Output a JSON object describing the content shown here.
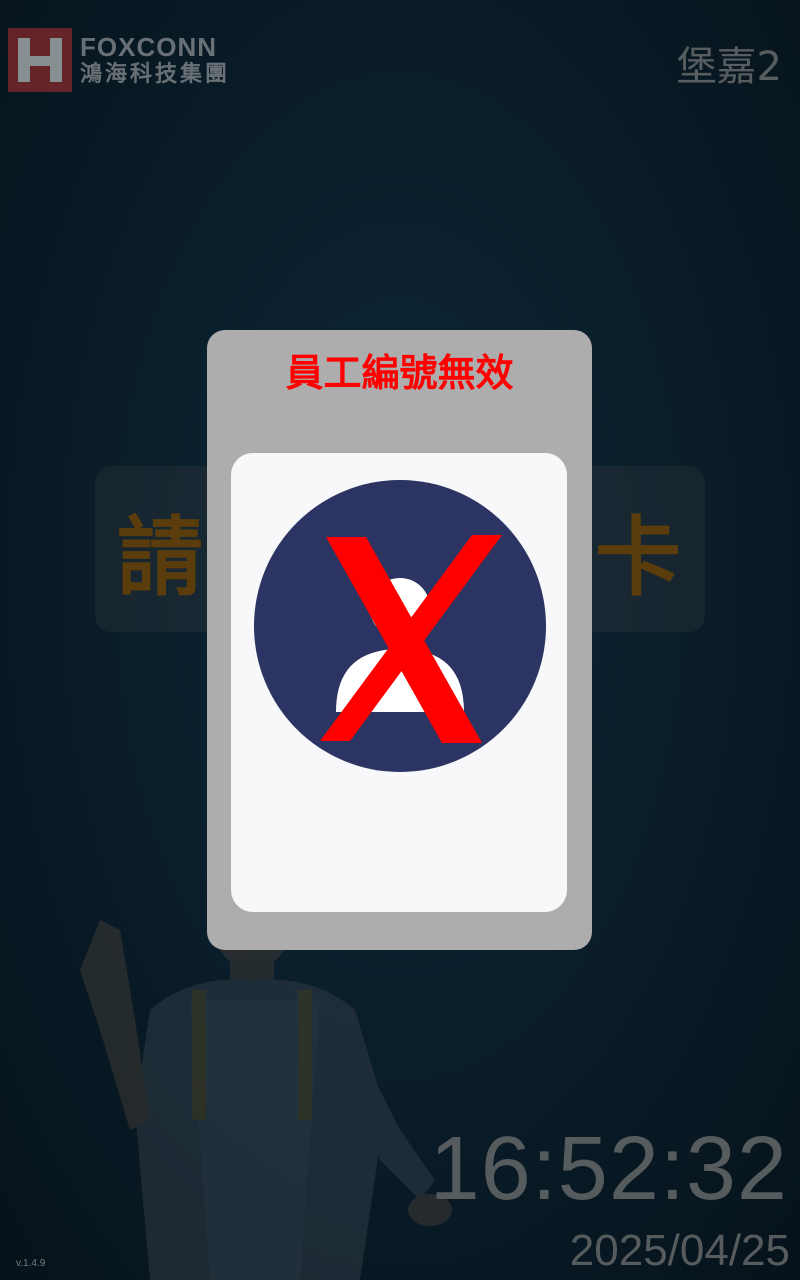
{
  "header": {
    "logo_en": "FOXCONN",
    "logo_zh": "鴻海科技集團",
    "site_name": "堡嘉2"
  },
  "prompt": {
    "left": "請",
    "right": "卡"
  },
  "dialog": {
    "title": "員工編號無效",
    "icon": "invalid-user-icon"
  },
  "footer": {
    "time": "16:52:32",
    "date": "2025/04/25",
    "version": "v.1.4.9"
  },
  "colors": {
    "dialog_title": "#ff0000",
    "avatar_bg": "#2b3462",
    "cross": "#ff0000"
  }
}
